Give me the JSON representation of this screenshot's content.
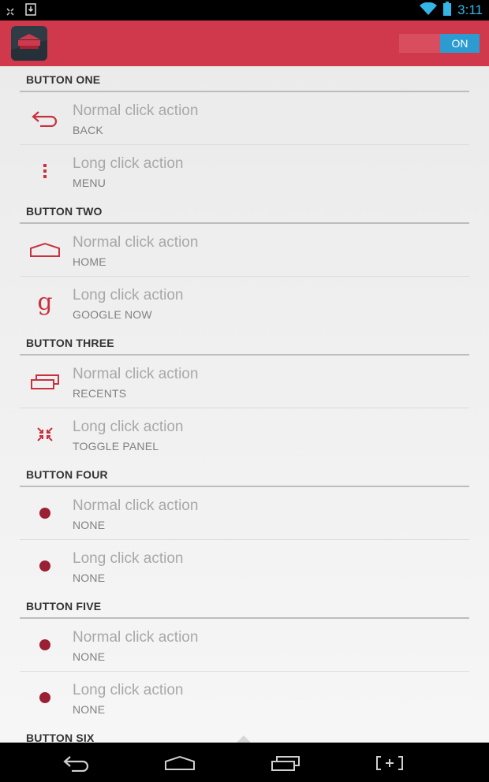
{
  "status_bar": {
    "time": "3:11",
    "accent_color": "#33b5e5",
    "icons": [
      "notification-icon",
      "download-icon",
      "wifi-icon",
      "battery-icon"
    ]
  },
  "action_bar": {
    "background": "#d0384b",
    "toggle_label": "ON",
    "app_icon": "app-icon"
  },
  "sections": [
    {
      "header": "BUTTON ONE",
      "rows": [
        {
          "title": "Normal click action",
          "value": "BACK",
          "icon": "back-icon"
        },
        {
          "title": "Long click action",
          "value": "MENU",
          "icon": "menu-icon"
        }
      ]
    },
    {
      "header": "BUTTON TWO",
      "rows": [
        {
          "title": "Normal click action",
          "value": "HOME",
          "icon": "home-icon"
        },
        {
          "title": "Long click action",
          "value": "GOOGLE NOW",
          "icon": "google-icon",
          "glyph": "g"
        }
      ]
    },
    {
      "header": "BUTTON THREE",
      "rows": [
        {
          "title": "Normal click action",
          "value": "RECENTS",
          "icon": "recents-icon"
        },
        {
          "title": "Long click action",
          "value": "TOGGLE PANEL",
          "icon": "toggle-panel-icon"
        }
      ]
    },
    {
      "header": "BUTTON FOUR",
      "rows": [
        {
          "title": "Normal click action",
          "value": "NONE",
          "icon": "dot-icon"
        },
        {
          "title": "Long click action",
          "value": "NONE",
          "icon": "dot-icon"
        }
      ]
    },
    {
      "header": "BUTTON FIVE",
      "rows": [
        {
          "title": "Normal click action",
          "value": "NONE",
          "icon": "dot-icon"
        },
        {
          "title": "Long click action",
          "value": "NONE",
          "icon": "dot-icon"
        }
      ]
    },
    {
      "header": "BUTTON SIX",
      "rows": []
    }
  ],
  "nav_bar": {
    "buttons": [
      "back-icon",
      "home-icon",
      "recents-icon",
      "expand-icon"
    ]
  }
}
